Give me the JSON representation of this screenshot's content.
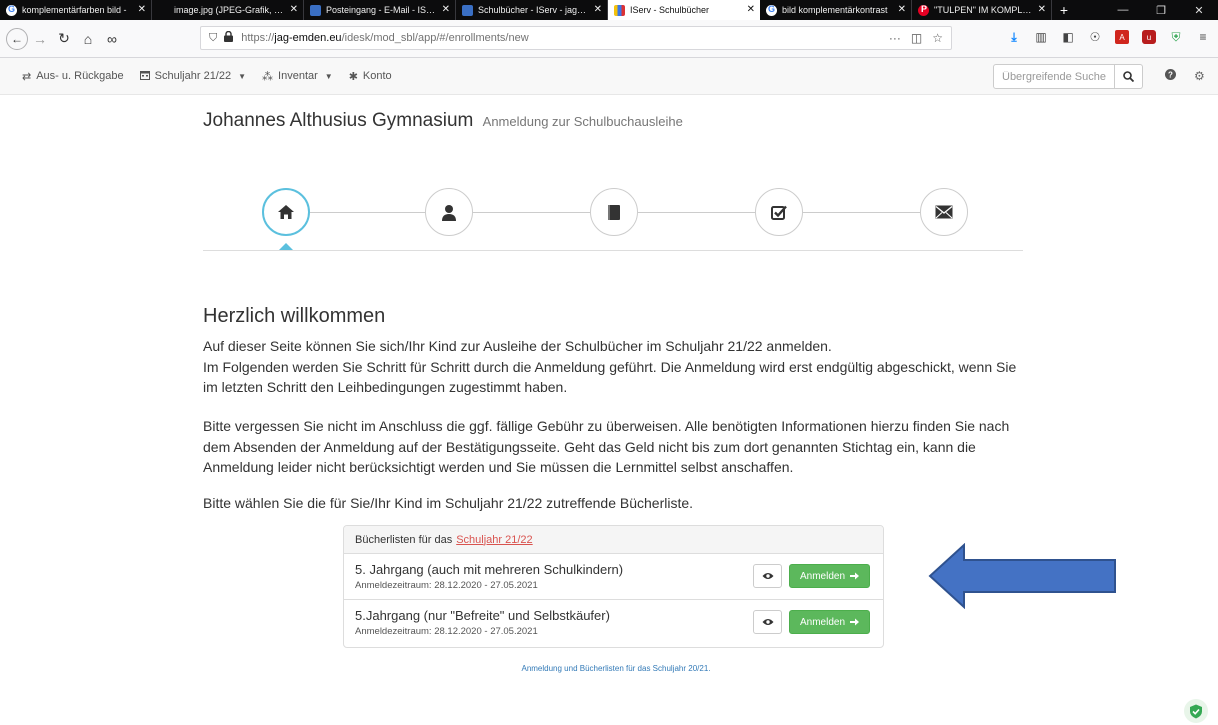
{
  "browser": {
    "tabs": [
      {
        "title": "komplementärfarben bild - ",
        "icon": "google-icon"
      },
      {
        "title": "image.jpg (JPEG-Grafik, 394 × 5",
        "icon": "image-icon"
      },
      {
        "title": "Posteingang - E-Mail - IServ",
        "icon": "iserv-icon"
      },
      {
        "title": "Schulbücher - IServ - jag-em",
        "icon": "iserv-icon"
      },
      {
        "title": "IServ - Schulbücher",
        "icon": "books-icon",
        "active": true
      },
      {
        "title": "bild komplementärkontrast",
        "icon": "google-icon"
      },
      {
        "title": "\"TULPEN\" IM KOMPLEMENT",
        "icon": "pinterest-icon"
      }
    ],
    "url_prefix": "https://",
    "url_host": "jag-emden.eu",
    "url_path": "/idesk/mod_sbl/app/#/enrollments/new"
  },
  "appbar": {
    "returns": "Aus- u. Rückgabe",
    "schoolyear": "Schuljahr 21/22",
    "inventory": "Inventar",
    "account": "Konto",
    "search_placeholder": "Übergreifende Suche"
  },
  "header": {
    "school": "Johannes Althusius Gymnasium",
    "subtitle": "Anmeldung zur Schulbuchausleihe"
  },
  "wizard": {
    "steps": [
      "home-icon",
      "user-icon",
      "book-icon",
      "checkbox-icon",
      "envelope-icon"
    ],
    "active_step": 0
  },
  "content": {
    "heading": "Herzlich willkommen",
    "p1_line1": "Auf dieser Seite können Sie sich/Ihr Kind zur Ausleihe der Schulbücher im Schuljahr 21/22 anmelden.",
    "p1_line2": "Im Folgenden werden Sie Schritt für Schritt durch die Anmeldung geführt. Die Anmeldung wird erst endgültig abgeschickt, wenn Sie im letzten Schritt den Leihbedingungen zugestimmt haben.",
    "p2": "Bitte vergessen Sie nicht im Anschluss die ggf. fällige Gebühr zu überweisen. Alle benötigten Informationen hierzu finden Sie nach dem Absenden der Anmeldung auf der Bestätigungsseite. Geht das Geld nicht bis zum dort genannten Stichtag ein, kann die Anmeldung leider nicht berücksichtigt werden und Sie müssen die Lernmittel selbst anschaffen.",
    "p3": "Bitte wählen Sie die für Sie/Ihr Kind im Schuljahr 21/22 zutreffende Bücherliste."
  },
  "booklists": {
    "header_text": "Bücherlisten für das",
    "header_link": "Schuljahr 21/22",
    "rows": [
      {
        "title": "5. Jahrgang (auch mit mehreren Schulkindern)",
        "period": "Anmeldezeitraum: 28.12.2020 - 27.05.2021",
        "button": "Anmelden"
      },
      {
        "title": "5.Jahrgang (nur \"Befreite\" und Selbstkäufer)",
        "period": "Anmeldezeitraum: 28.12.2020 - 27.05.2021",
        "button": "Anmelden"
      }
    ],
    "footer_link": "Anmeldung und Bücherlisten für das Schuljahr 20/21."
  },
  "colors": {
    "accent": "#5bc0de",
    "success": "#5cb85c",
    "link": "#337ab7",
    "danger_link": "#d9534f",
    "annotation_arrow": "#4472c4"
  }
}
